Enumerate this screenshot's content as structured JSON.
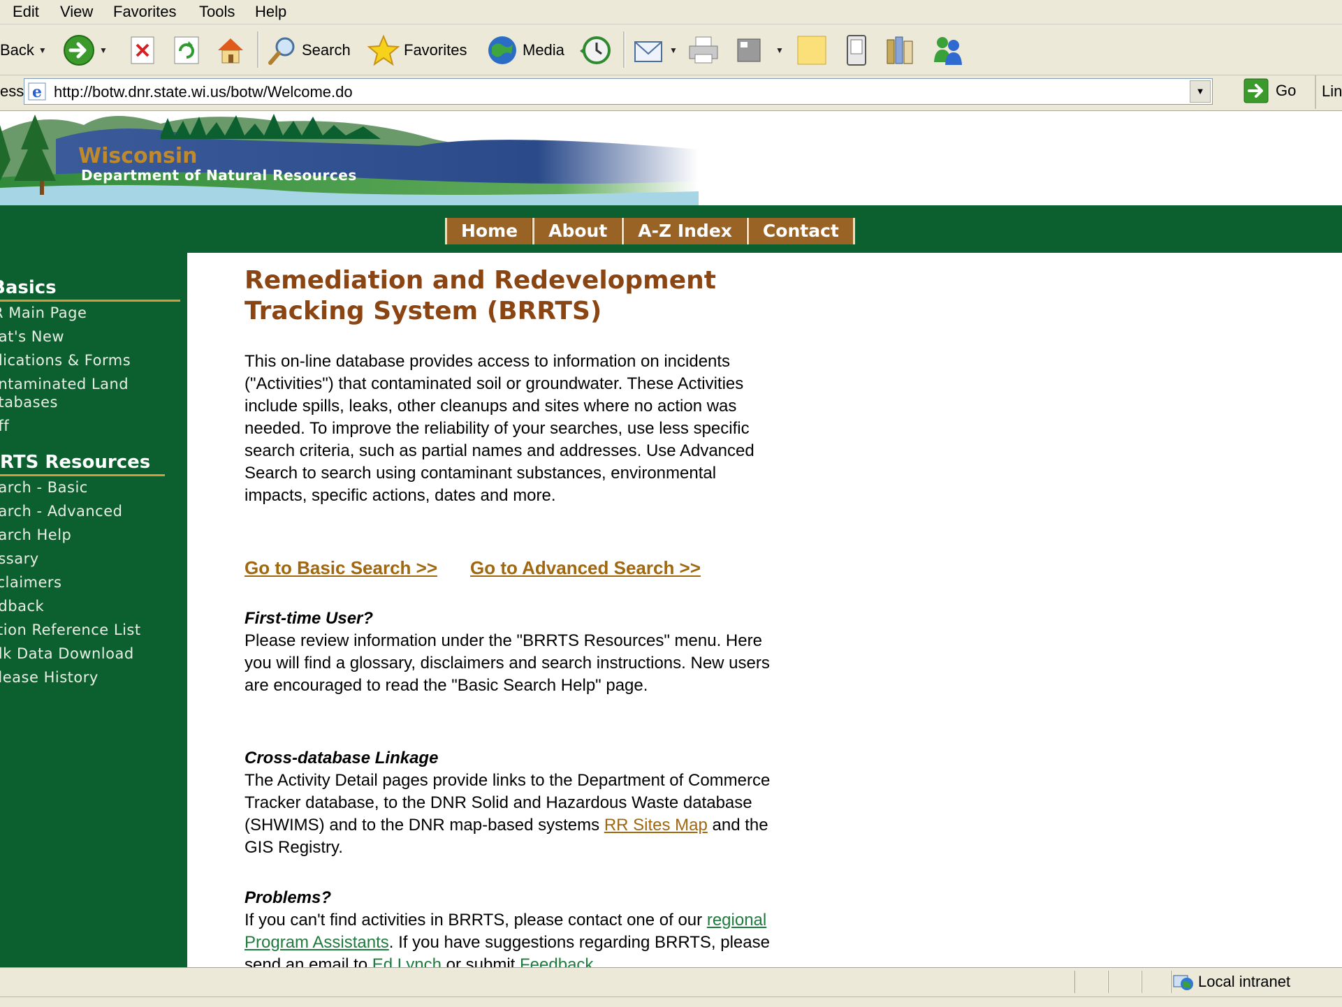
{
  "menu": [
    "Edit",
    "View",
    "Favorites",
    "Tools",
    "Help"
  ],
  "toolbar": {
    "back": "Back",
    "search": "Search",
    "favorites": "Favorites",
    "media": "Media"
  },
  "address": {
    "label": "ess",
    "url": "http://botw.dnr.state.wi.us/botw/Welcome.do",
    "go": "Go",
    "links": "Lin"
  },
  "banner": {
    "line1": "Wisconsin",
    "line2": "Department of Natural Resources"
  },
  "nav": [
    "Home",
    "About",
    "A-Z Index",
    "Contact"
  ],
  "sidebar": {
    "section1": "Basics",
    "items1": [
      "Main Page",
      "hat's New",
      "blications & Forms",
      "ontaminated Land",
      "atabases",
      "aff"
    ],
    "section2": "RTS Resources",
    "items2": [
      "earch - Basic",
      "earch - Advanced",
      "earch Help",
      "ossary",
      "sclaimers",
      "edback",
      "ction Reference List",
      "ulk Data Download",
      "elease History"
    ]
  },
  "main": {
    "title_line1": "Remediation and Redevelopment",
    "title_line2": "Tracking System (BRRTS)",
    "intro": "This on-line database provides access to information on incidents (\"Activities\") that contaminated soil or groundwater. These Activities include spills, leaks, other cleanups and sites where no action was needed. To improve the reliability of your searches, use less specific search criteria, such as partial names and addresses. Use Advanced Search to search using contaminant substances, environmental impacts, specific actions, dates and more.",
    "basic_search_link": "Go to Basic Search >>",
    "advanced_search_link": "Go to Advanced Search >>",
    "first_time_heading": "First-time User?",
    "first_time_text": "Please review information under the \"BRRTS Resources\" menu. Here you will find a glossary, disclaimers and search instructions. New users are encouraged to read the \"Basic Search Help\" page.",
    "cross_heading": "Cross-database Linkage",
    "cross_text": "The Activity Detail pages provide links to the Department of Commerce Tracker database, to the DNR Solid and Hazardous Waste database (SHWIMS) and to the DNR map-based systems",
    "rr_sites_link": "RR Sites Map",
    "cross_text_end": "and the GIS Registry.",
    "problems_heading": "Problems?",
    "problems_text1": "If you can't find activities in BRRTS, please contact one of our",
    "assistants_link": "regional Program Assistants",
    "problems_text2": ". If you have suggestions regarding BRRTS, please send an email to",
    "ed_link": "Ed Lynch",
    "problems_text3": "or submit",
    "feedback_link": "Feedback"
  },
  "status": {
    "zone": "Local intranet"
  },
  "colors": {
    "dnr_green": "#0c6030",
    "nav_brown": "#9a6326",
    "title_brown": "#8b4513",
    "link_orange": "#a0670f",
    "link_green": "#1f7a3d"
  }
}
